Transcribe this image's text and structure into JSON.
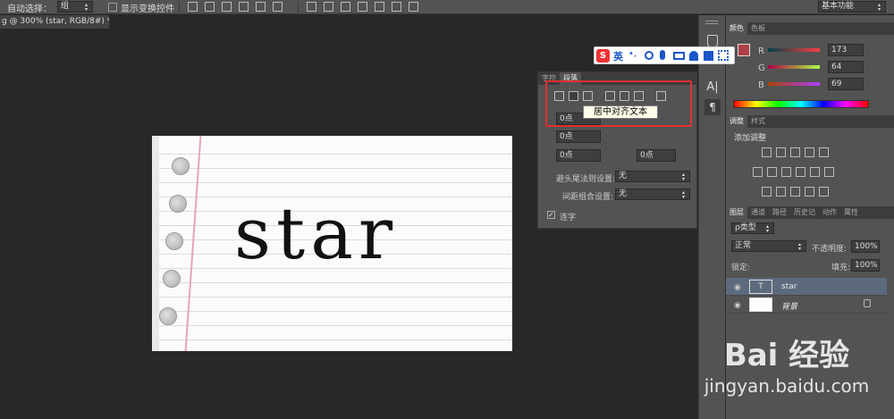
{
  "options_bar": {
    "auto_select_label": "自动选择：",
    "auto_select_value": "组",
    "show_transform": "显示变换控件",
    "workspace": "基本功能"
  },
  "document_tab": {
    "title": "g @ 300% (star, RGB/8#) *",
    "close": "×"
  },
  "canvas": {
    "text": "star"
  },
  "ime_toolbar": {
    "badge": "S",
    "lang": "英",
    "punct": "•,"
  },
  "color_panel": {
    "tabs": [
      "颜色",
      "色板"
    ],
    "r_label": "R",
    "g_label": "G",
    "b_label": "B",
    "r": "173",
    "g": "64",
    "b": "69",
    "fg_color": "#ad4045"
  },
  "adjust_panel": {
    "tabs": [
      "调整",
      "样式"
    ],
    "title": "添加调整"
  },
  "para_panel": {
    "tabs": [
      "字符",
      "段落"
    ],
    "fields": [
      "0点",
      "0点",
      "0点",
      "0点"
    ],
    "hyphen_label": "避头尾法则设置:",
    "hyphen_value": "无",
    "spacing_label": "间距组合设置:",
    "spacing_value": "无",
    "hyphenate": "连字",
    "tooltip": "居中对齐文本"
  },
  "layers_panel": {
    "tabs": [
      "图层",
      "通道",
      "路径",
      "历史记",
      "动作",
      "属性"
    ],
    "kind": "ρ类型",
    "blend": "正常",
    "opacity_label": "不透明度:",
    "opacity": "100%",
    "lock_label": "锁定:",
    "fill_label": "填充:",
    "fill": "100%",
    "layers": [
      {
        "name": "star",
        "type": "T"
      },
      {
        "name": "背景",
        "type": "img"
      }
    ]
  },
  "watermark": {
    "brand": "Bai 经验",
    "url": "jingyan.baidu.com"
  }
}
